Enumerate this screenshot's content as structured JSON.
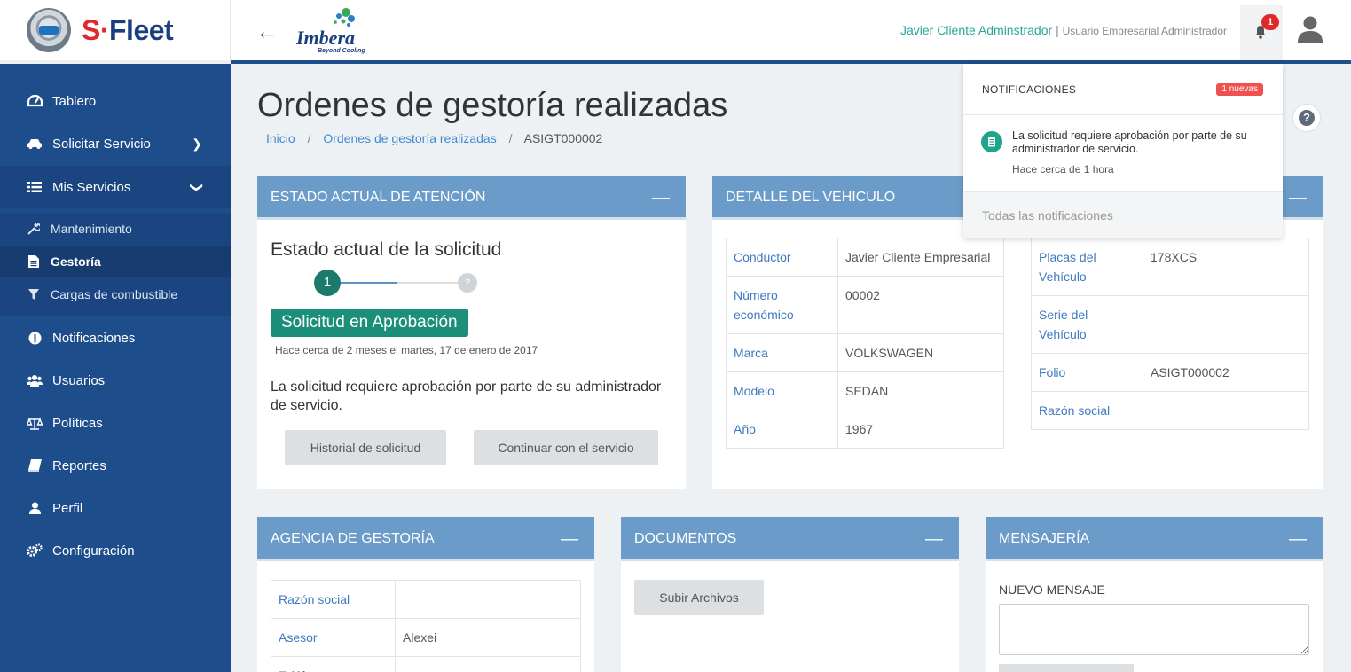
{
  "header": {
    "logo_text_s": "S",
    "logo_text_fleet": "Fleet",
    "partner_logo_word": "Imbera",
    "partner_logo_tagline": "Beyond Cooling",
    "user_name": "Javier Cliente Adminstrador",
    "separator": "|",
    "user_role": "Usuario Empresarial Administrador",
    "notification_count": "1",
    "back_glyph": "←",
    "accent_color": "#2aa69a",
    "brand_color": "#1e4d8c"
  },
  "sidebar": {
    "items": [
      {
        "label": "Tablero",
        "icon": "dashboard-icon"
      },
      {
        "label": "Solicitar Servicio",
        "icon": "car-icon"
      },
      {
        "label": "Mis Servicios",
        "icon": "list-icon"
      },
      {
        "label": "Notificaciones",
        "icon": "alert-icon"
      },
      {
        "label": "Usuarios",
        "icon": "users-icon"
      },
      {
        "label": "Políticas",
        "icon": "balance-icon"
      },
      {
        "label": "Reportes",
        "icon": "book-icon"
      },
      {
        "label": "Perfil",
        "icon": "user-icon"
      },
      {
        "label": "Configuración",
        "icon": "cogs-icon"
      }
    ],
    "sub_items": [
      {
        "label": "Mantenimiento",
        "icon": "wrench-icon"
      },
      {
        "label": "Gestoría",
        "icon": "document-icon"
      },
      {
        "label": "Cargas de combustible",
        "icon": "filter-icon"
      }
    ]
  },
  "main": {
    "title": "Ordenes de gestoría realizadas",
    "breadcrumb": {
      "home": "Inicio",
      "section": "Ordenes de gestoría realizadas",
      "current": "ASIGT000002",
      "sep": "/"
    }
  },
  "estado": {
    "header": "ESTADO ACTUAL DE ATENCIÓN",
    "minimize": "—",
    "title": "Estado actual de la solicitud",
    "step1": "1",
    "step2": "?",
    "badge": "Solicitud en Aprobación",
    "time": "Hace cerca de 2 meses el martes, 17 de enero de 2017",
    "message": "La solicitud requiere aprobación por parte de su administrador de servicio.",
    "btn_history": "Historial de solicitud",
    "btn_continue": "Continuar con el servicio"
  },
  "vehiculo": {
    "header": "DETALLE DEL VEHICULO",
    "minimize": "—",
    "left_rows": [
      {
        "k": "Conductor",
        "v": "Javier Cliente Empresarial"
      },
      {
        "k": "Número económico",
        "v": "00002"
      },
      {
        "k": "Marca",
        "v": "VOLKSWAGEN"
      },
      {
        "k": "Modelo",
        "v": "SEDAN"
      },
      {
        "k": "Año",
        "v": "1967"
      }
    ],
    "right_rows": [
      {
        "k": "Placas del Vehículo",
        "v": "178XCS"
      },
      {
        "k": "Serie del Vehículo",
        "v": ""
      },
      {
        "k": "Folio",
        "v": "ASIGT000002"
      },
      {
        "k": "Razón social",
        "v": ""
      }
    ]
  },
  "agencia": {
    "header": "AGENCIA DE GESTORÍA",
    "minimize": "—",
    "rows": [
      {
        "k": "Razón social",
        "v": ""
      },
      {
        "k": "Asesor",
        "v": "Alexei"
      },
      {
        "k": "Teléfono",
        "v": ""
      }
    ]
  },
  "documentos": {
    "header": "DOCUMENTOS",
    "minimize": "—",
    "upload_btn": "Subir Archivos"
  },
  "mensajeria": {
    "header": "MENSAJERÍA",
    "minimize": "—",
    "new_label": "NUEVO MENSAJE",
    "textarea_value": ""
  },
  "notifications": {
    "title": "NOTIFICACIONES",
    "badge": "1 nuevas",
    "item_text": "La solicitud requiere aprobación por parte de su administrador de servicio.",
    "item_time": "Hace cerca de 1 hora",
    "footer": "Todas las notificaciones"
  }
}
